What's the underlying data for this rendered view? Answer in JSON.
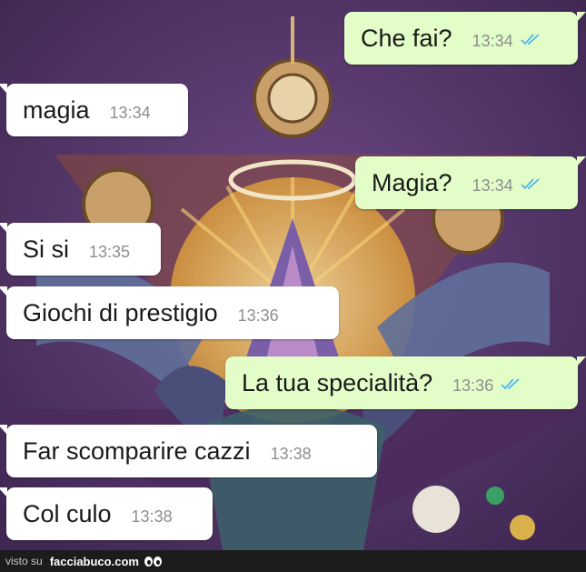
{
  "messages": [
    {
      "dir": "out",
      "text": "Che fai?",
      "time": "13:34",
      "read": true
    },
    {
      "dir": "in",
      "text": "magia",
      "time": "13:34"
    },
    {
      "dir": "out",
      "text": "Magia?",
      "time": "13:34",
      "read": true
    },
    {
      "dir": "in",
      "text": "Si si",
      "time": "13:35"
    },
    {
      "dir": "in",
      "text": "Giochi di prestigio",
      "time": "13:36"
    },
    {
      "dir": "out",
      "text": "La tua specialità?",
      "time": "13:36",
      "read": true
    },
    {
      "dir": "in",
      "text": "Far scomparire cazzi",
      "time": "13:38"
    },
    {
      "dir": "in",
      "text": "Col culo",
      "time": "13:38"
    }
  ],
  "footer": {
    "prefix": "visto su",
    "site": "facciabuco.com"
  },
  "colors": {
    "incoming": "#ffffff",
    "outgoing": "#e2fdc8",
    "read_tick": "#4fb6ec",
    "timestamp": "#8e8e8e"
  },
  "icons": {
    "read_receipt": "double-check-icon",
    "footer_logo": "eyes-icon"
  }
}
